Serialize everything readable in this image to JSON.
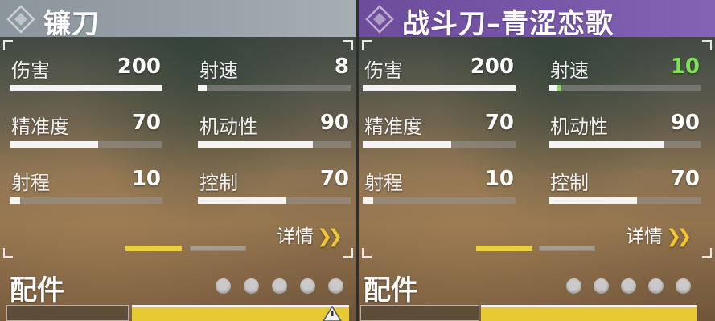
{
  "left_panel": {
    "title": "镰刀",
    "header_color": "#9aa3a9",
    "stats": [
      {
        "label": "伤害",
        "value": "200",
        "fill": 1.0
      },
      {
        "label": "射速",
        "value": "8",
        "fill": 0.06
      },
      {
        "label": "精准度",
        "value": "70",
        "fill": 0.58
      },
      {
        "label": "机动性",
        "value": "90",
        "fill": 0.75
      },
      {
        "label": "射程",
        "value": "10",
        "fill": 0.07
      },
      {
        "label": "控制",
        "value": "70",
        "fill": 0.58
      }
    ],
    "details_label": "详情",
    "details_icon": "double-chevron-right-icon",
    "pager": {
      "count": 2,
      "active": 0
    },
    "attachments_title": "配件",
    "attachment_dots": 5
  },
  "right_panel": {
    "title": "战斗刀–青涩恋歌",
    "header_color": "#7a58aa",
    "stats": [
      {
        "label": "伤害",
        "value": "200",
        "fill": 1.0
      },
      {
        "label": "射速",
        "value": "10",
        "fill": 0.06,
        "delta": 0.02,
        "highlight": "#7ee05c"
      },
      {
        "label": "精准度",
        "value": "70",
        "fill": 0.58
      },
      {
        "label": "机动性",
        "value": "90",
        "fill": 0.75
      },
      {
        "label": "射程",
        "value": "10",
        "fill": 0.07
      },
      {
        "label": "控制",
        "value": "70",
        "fill": 0.58
      }
    ],
    "details_label": "详情",
    "details_icon": "double-chevron-right-icon",
    "pager": {
      "count": 2,
      "active": 0
    },
    "attachments_title": "配件",
    "attachment_dots": 5
  },
  "colors": {
    "accent_yellow": "#e8cf46",
    "stat_up": "#7ee05c"
  }
}
